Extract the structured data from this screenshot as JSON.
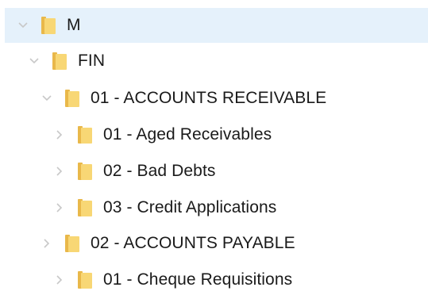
{
  "tree": {
    "items": [
      {
        "label": "M",
        "expanded": true,
        "selected": true,
        "icon": "folder-icon"
      },
      {
        "label": "FIN",
        "expanded": true,
        "selected": false,
        "icon": "folder-icon"
      },
      {
        "label": "01 - ACCOUNTS RECEIVABLE",
        "expanded": true,
        "selected": false,
        "icon": "folder-icon"
      },
      {
        "label": "01 - Aged Receivables",
        "expanded": false,
        "selected": false,
        "icon": "folder-icon"
      },
      {
        "label": "02 - Bad Debts",
        "expanded": false,
        "selected": false,
        "icon": "folder-icon"
      },
      {
        "label": "03 - Credit Applications",
        "expanded": false,
        "selected": false,
        "icon": "folder-icon"
      },
      {
        "label": "02 - ACCOUNTS PAYABLE",
        "expanded": false,
        "selected": false,
        "icon": "folder-icon"
      },
      {
        "label": "01 - Cheque Requisitions",
        "expanded": false,
        "selected": false,
        "icon": "folder-icon"
      }
    ]
  },
  "colors": {
    "selection": "#e5f1fb",
    "chevron": "#c8c8c8",
    "folder_back": "#e9b84a",
    "folder_front": "#f8d775",
    "text": "#1a1a1a"
  }
}
